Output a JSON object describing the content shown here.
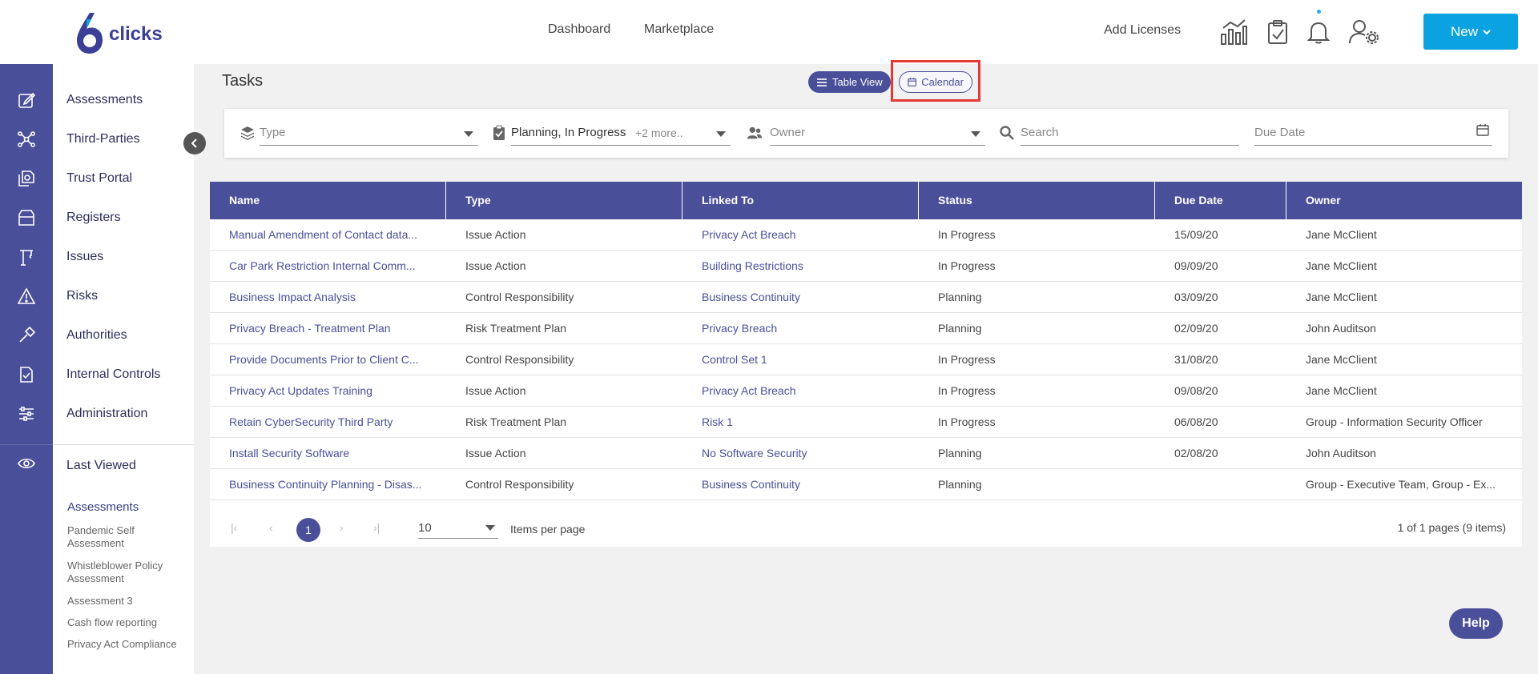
{
  "header": {
    "logo_text": "clicks",
    "nav": [
      "Dashboard",
      "Marketplace"
    ],
    "add_licenses": "Add Licenses",
    "new_button": "New",
    "icons": [
      "analytics-icon",
      "clipboard-check-icon",
      "bell-icon",
      "user-settings-icon"
    ]
  },
  "rail_icons": [
    "edit-icon",
    "network-icon",
    "documents-icon",
    "archive-box-icon",
    "crane-icon",
    "warning-icon",
    "hammer-icon",
    "checklist-icon",
    "sliders-icon",
    "eye-icon"
  ],
  "sidebar": {
    "items": [
      "Assessments",
      "Third-Parties",
      "Trust Portal",
      "Registers",
      "Issues",
      "Risks",
      "Authorities",
      "Internal Controls",
      "Administration"
    ],
    "last_viewed": "Last Viewed",
    "lv_section": "Assessments",
    "lv_items": [
      "Pandemic Self Assessment",
      "Whistleblower Policy Assessment",
      "Assessment 3",
      "Cash flow reporting",
      "Privacy Act Compliance"
    ]
  },
  "main": {
    "title": "Tasks",
    "table_view_label": "Table View",
    "calendar_label": "Calendar"
  },
  "filters": {
    "type_placeholder": "Type",
    "status_value": "Planning, In Progress",
    "status_more": "+2 more..",
    "owner_placeholder": "Owner",
    "search_placeholder": "Search",
    "due_date_placeholder": "Due Date"
  },
  "table": {
    "columns": [
      "Name",
      "Type",
      "Linked To",
      "Status",
      "Due Date",
      "Owner"
    ],
    "rows": [
      [
        "Manual Amendment of Contact data...",
        "Issue Action",
        "Privacy Act Breach",
        "In Progress",
        "15/09/20",
        "Jane McClient"
      ],
      [
        "Car Park Restriction Internal Comm...",
        "Issue Action",
        "Building Restrictions",
        "In Progress",
        "09/09/20",
        "Jane McClient"
      ],
      [
        "Business Impact Analysis",
        "Control Responsibility",
        "Business Continuity",
        "Planning",
        "03/09/20",
        "Jane McClient"
      ],
      [
        "Privacy Breach - Treatment Plan",
        "Risk Treatment Plan",
        "Privacy Breach",
        "Planning",
        "02/09/20",
        "John Auditson"
      ],
      [
        "Provide Documents Prior to Client C...",
        "Control Responsibility",
        "Control Set 1",
        "In Progress",
        "31/08/20",
        "Jane McClient"
      ],
      [
        "Privacy Act Updates Training",
        "Issue Action",
        "Privacy Act Breach",
        "In Progress",
        "09/08/20",
        "Jane McClient"
      ],
      [
        "Retain CyberSecurity Third Party",
        "Risk Treatment Plan",
        "Risk 1",
        "In Progress",
        "06/08/20",
        "Group - Information Security Officer"
      ],
      [
        "Install Security Software",
        "Issue Action",
        "No Software Security",
        "Planning",
        "02/08/20",
        "John Auditson"
      ],
      [
        "Business Continuity Planning - Disas...",
        "Control Responsibility",
        "Business Continuity",
        "Planning",
        "",
        "Group - Executive Team, Group - Ex..."
      ]
    ]
  },
  "pager": {
    "current_page": "1",
    "per_page": "10",
    "per_page_label": "Items per page",
    "info": "1 of 1 pages (9 items)"
  },
  "help_label": "Help",
  "colors": {
    "primary": "#4a4f9a",
    "accent": "#0aa2e0",
    "highlight": "#e53935"
  }
}
